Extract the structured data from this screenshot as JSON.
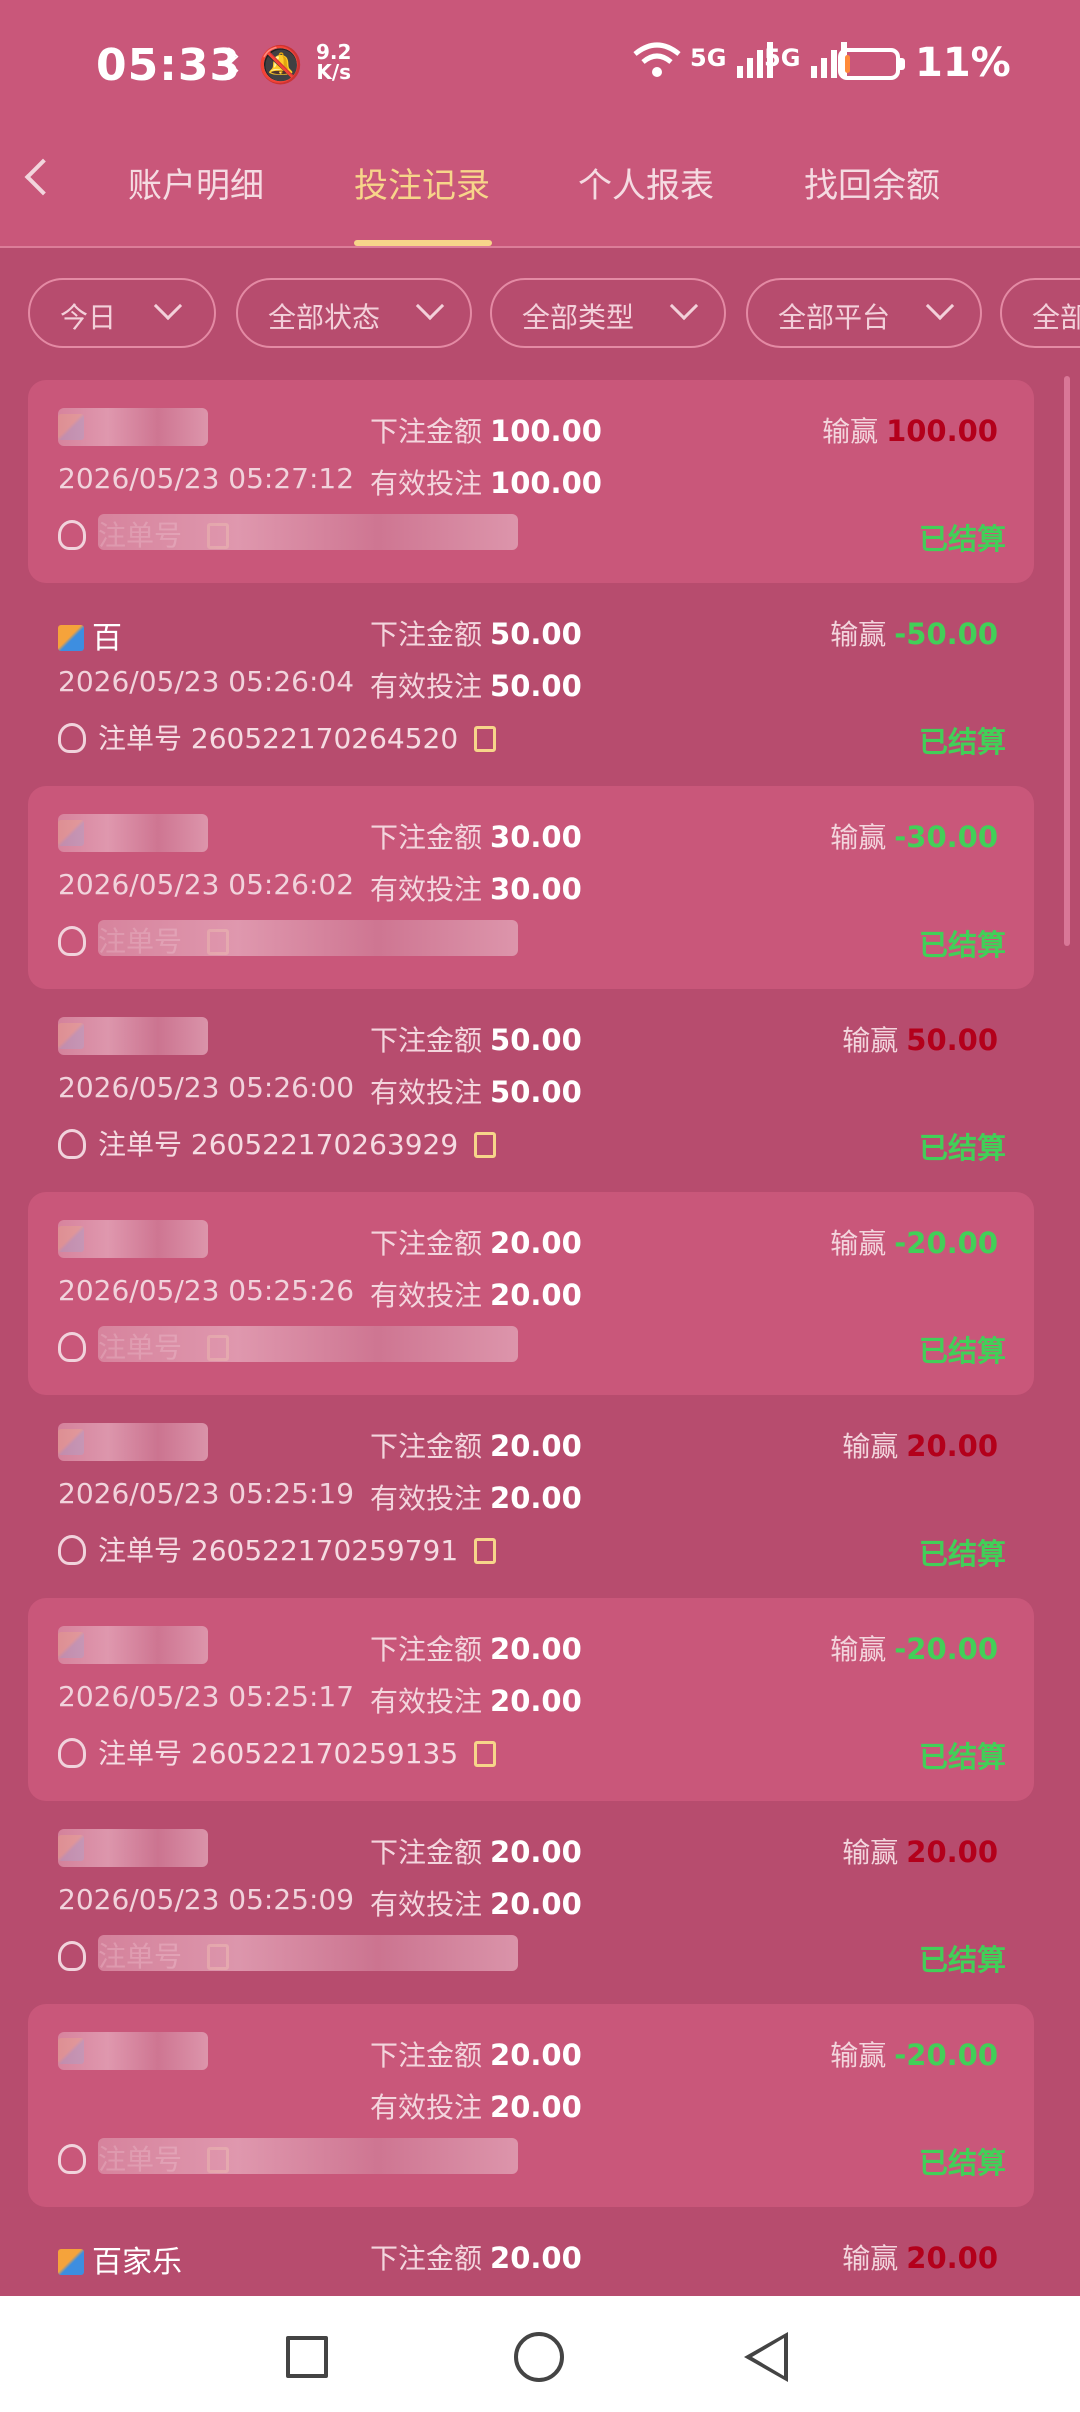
{
  "status_bar": {
    "time": "05:33",
    "net_speed": "9.2",
    "net_unit": "K/s",
    "sig1": "5G",
    "sig2": "5G",
    "battery_pct": "11%",
    "battery_level": 0.11
  },
  "tabs": [
    {
      "label": "账户明细",
      "active": false
    },
    {
      "label": "投注记录",
      "active": true
    },
    {
      "label": "个人报表",
      "active": false
    },
    {
      "label": "找回余额",
      "active": false
    }
  ],
  "filters": [
    {
      "label": "今日"
    },
    {
      "label": "全部状态"
    },
    {
      "label": "全部类型"
    },
    {
      "label": "全部平台"
    },
    {
      "label": "全部"
    }
  ],
  "labels": {
    "bet_amount": "下注金额",
    "valid_bet": "有效投注",
    "win_loss": "输赢",
    "order_no": "注单号"
  },
  "records": [
    {
      "game": "",
      "date": "2026/05/23 05:27:12",
      "bet": "100.00",
      "valid": "100.00",
      "result": "100.00",
      "result_sign": "pos",
      "order": "",
      "status": "已结算"
    },
    {
      "game": "百",
      "date": "2026/05/23 05:26:04",
      "bet": "50.00",
      "valid": "50.00",
      "result": "-50.00",
      "result_sign": "neg",
      "order": "260522170264520",
      "status": "已结算"
    },
    {
      "game": "",
      "date": "2026/05/23 05:26:02",
      "bet": "30.00",
      "valid": "30.00",
      "result": "-30.00",
      "result_sign": "neg",
      "order": "",
      "status": "已结算"
    },
    {
      "game": "",
      "date": "2026/05/23 05:26:00",
      "bet": "50.00",
      "valid": "50.00",
      "result": "50.00",
      "result_sign": "pos",
      "order": "260522170263929",
      "status": "已结算"
    },
    {
      "game": "",
      "date": "2026/05/23 05:25:26",
      "bet": "20.00",
      "valid": "20.00",
      "result": "-20.00",
      "result_sign": "neg",
      "order": "",
      "status": "已结算"
    },
    {
      "game": "",
      "date": "2026/05/23 05:25:19",
      "bet": "20.00",
      "valid": "20.00",
      "result": "20.00",
      "result_sign": "pos",
      "order": "260522170259791",
      "status": "已结算"
    },
    {
      "game": "",
      "date": "2026/05/23 05:25:17",
      "bet": "20.00",
      "valid": "20.00",
      "result": "-20.00",
      "result_sign": "neg",
      "order": "260522170259135",
      "status": "已结算"
    },
    {
      "game": "",
      "date": "2026/05/23 05:25:09",
      "bet": "20.00",
      "valid": "20.00",
      "result": "20.00",
      "result_sign": "pos",
      "order": "",
      "status": "已结算"
    },
    {
      "game": "",
      "date": "",
      "bet": "20.00",
      "valid": "20.00",
      "result": "-20.00",
      "result_sign": "neg",
      "order": "",
      "status": "已结算"
    },
    {
      "game": "百家乐",
      "date": "",
      "bet": "20.00",
      "valid": "",
      "result": "20.00",
      "result_sign": "pos",
      "order": "",
      "status": ""
    }
  ],
  "colors": {
    "background": "#b74c6e",
    "card": "#c9577a",
    "accent": "#f7d58a",
    "win_negative": "#42cf58",
    "win_positive": "#b3001b"
  },
  "icons": {
    "back": "chevron-left-icon",
    "filter": "chevron-down-icon",
    "copy": "copy-icon",
    "avatar": "user-avatar-icon",
    "game": "game-logo-icon"
  }
}
